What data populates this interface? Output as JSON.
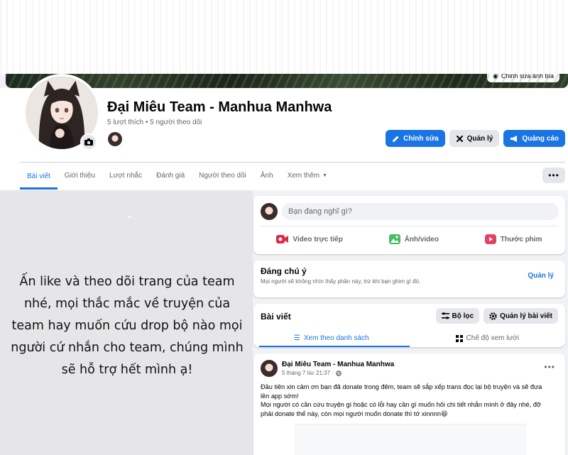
{
  "cover": {
    "edit_label": "Chỉnh sửa ảnh bìa"
  },
  "page": {
    "name": "Đại Miêu Team - Manhua Manhwa",
    "stats": "5 lượt thích • 5 người theo dõi"
  },
  "actions": {
    "edit": "Chỉnh sửa",
    "manage": "Quản lý",
    "advertise": "Quảng cáo"
  },
  "tabs": [
    "Bài viết",
    "Giới thiệu",
    "Lượt nhắc",
    "Đánh giá",
    "Người theo dõi",
    "Ảnh",
    "Xem thêm"
  ],
  "more_button": "•••",
  "notice_lines": [
    "Ấn like và theo dõi trang của team",
    "nhé, mọi thắc mắc về truyện của",
    "team hay muốn cứu drop bộ nào mọi",
    "người cứ nhắn cho team, chúng mình",
    "sẽ hỗ trợ hết mình ạ!"
  ],
  "composer": {
    "placeholder": "Bạn đang nghĩ gì?",
    "options": [
      "Video trực tiếp",
      "Ảnh/video",
      "Thước phim"
    ]
  },
  "pinned": {
    "title": "Đáng chú ý",
    "subtitle": "Mọi người sẽ không nhìn thấy phần này, trừ khi bạn ghim gì đó.",
    "manage": "Quản lý"
  },
  "posts": {
    "title": "Bài viết",
    "filter": "Bộ lọc",
    "manage": "Quản lý bài viết",
    "list_view": "Xem theo danh sách",
    "grid_view": "Chế độ xem lưới"
  },
  "post": {
    "author": "Đại Miêu Team - Manhua Manhwa",
    "time": "5 tháng 7 lúc 21:37 ·",
    "dots": "•••",
    "lines": [
      "Đầu tiên xin cảm ơn bạn đã donate trong đêm, team sẽ sắp xếp trans đọc lại bộ truyện và sẽ đưa",
      "lên app sớm!",
      "Mọi người có cần cứu truyện gì hoặc có lỗi hay cần gì muốn hỏi chi tiết nhắn mình ở đây nhé, đỡ",
      "phải donate thế này, còn mọi người muốn donate thì tớ xinnnn😆"
    ]
  },
  "colors": {
    "accent": "#1b74e4",
    "background": "#f0f2f5",
    "text_secondary": "#65676b"
  }
}
